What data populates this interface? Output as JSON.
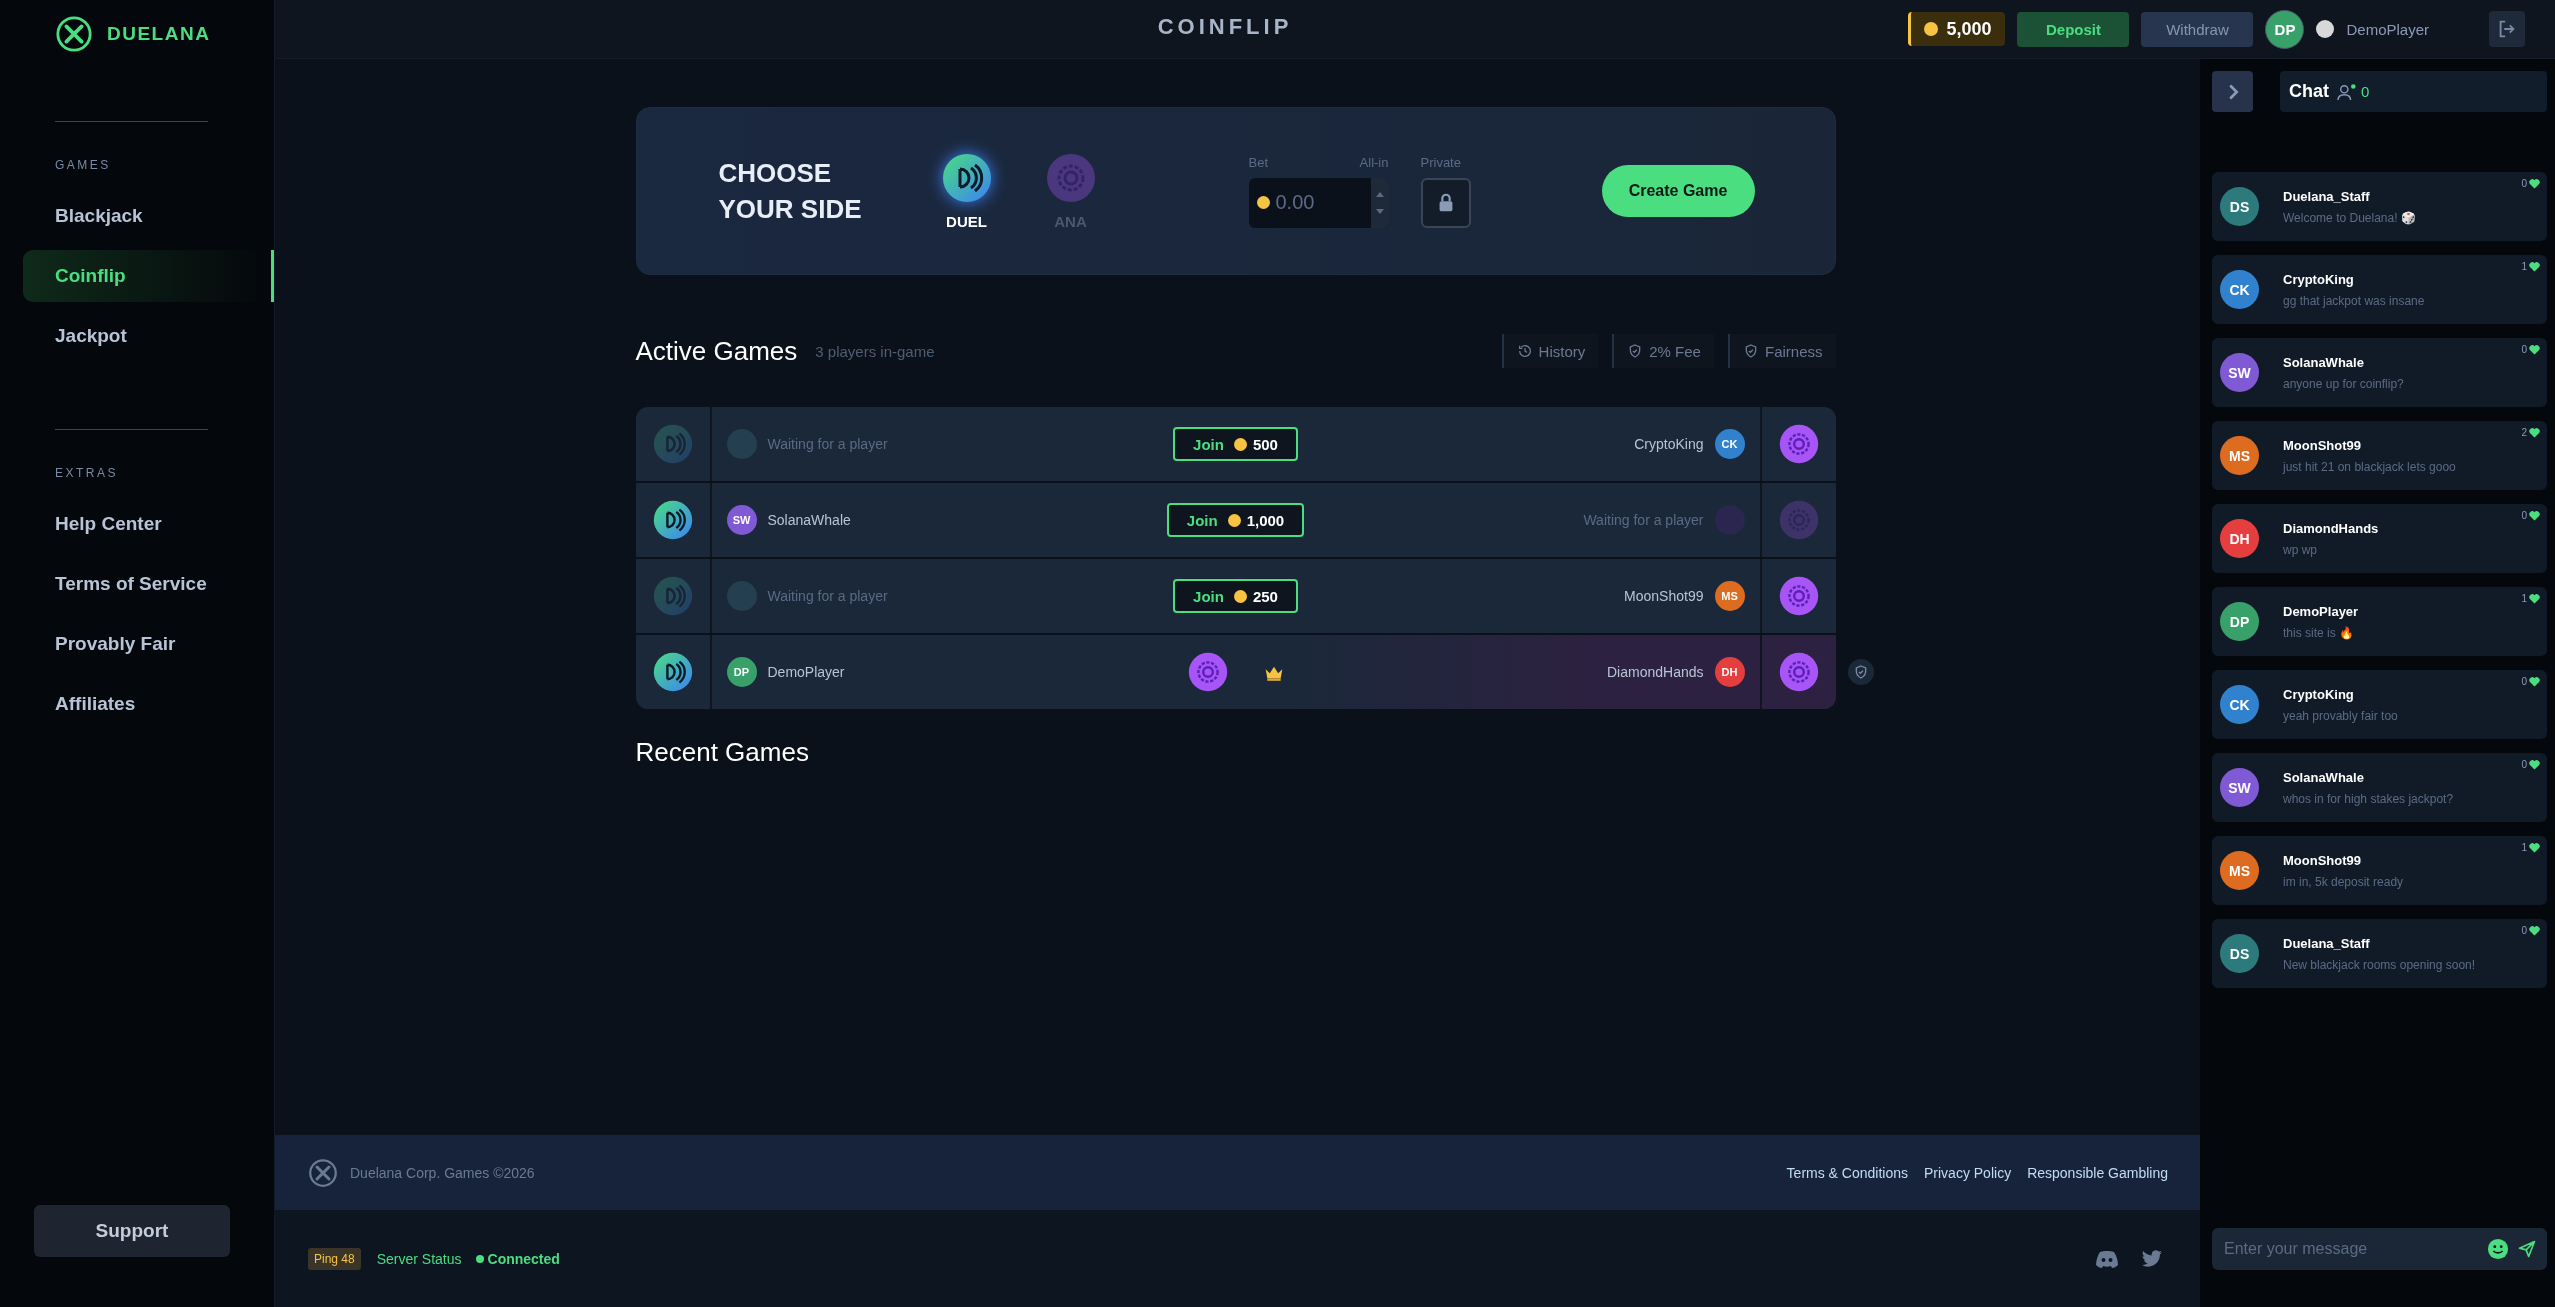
{
  "brand": {
    "name": "DUELANA"
  },
  "sidebar": {
    "sections": [
      {
        "heading": "GAMES",
        "items": [
          {
            "label": "Blackjack",
            "selected": false
          },
          {
            "label": "Coinflip",
            "selected": true
          },
          {
            "label": "Jackpot",
            "selected": false
          }
        ]
      },
      {
        "heading": "EXTRAS",
        "items": [
          {
            "label": "Help Center",
            "selected": false
          },
          {
            "label": "Terms of Service",
            "selected": false
          },
          {
            "label": "Provably Fair",
            "selected": false
          },
          {
            "label": "Affiliates",
            "selected": false
          }
        ]
      }
    ],
    "support": "Support"
  },
  "header": {
    "title": "COINFLIP",
    "balance": "5,000",
    "deposit": "Deposit",
    "withdraw": "Withdraw",
    "avatar": "DP",
    "username": "DemoPlayer"
  },
  "creator": {
    "heading": [
      "CHOOSE",
      "YOUR SIDE"
    ],
    "sides": [
      {
        "label": "DUEL",
        "kind": "duel",
        "selected": true
      },
      {
        "label": "ANA",
        "kind": "ana",
        "selected": false
      }
    ],
    "bet_label": "Bet",
    "all_in": "All-in",
    "bet_placeholder": "0.00",
    "private_label": "Private",
    "create": "Create Game"
  },
  "active_games": {
    "title": "Active Games",
    "subtitle": "3 players in-game",
    "tools": [
      {
        "label": "History",
        "kind": "history"
      },
      {
        "label": "2% Fee",
        "kind": "shield"
      },
      {
        "label": "Fairness",
        "kind": "shield"
      }
    ],
    "rows": [
      {
        "kind": "open",
        "left": {
          "waiting": true,
          "text": "Waiting for a player"
        },
        "amount": "500",
        "join": "Join",
        "right": {
          "waiting": false,
          "text": "CryptoKing",
          "initials": "CK",
          "color": "#3182ce"
        }
      },
      {
        "kind": "open",
        "left": {
          "waiting": false,
          "text": "SolanaWhale",
          "initials": "SW",
          "color": "#805ad5"
        },
        "amount": "1,000",
        "join": "Join",
        "right": {
          "waiting": true,
          "text": "Waiting for a player"
        }
      },
      {
        "kind": "open",
        "left": {
          "waiting": true,
          "text": "Waiting for a player"
        },
        "amount": "250",
        "join": "Join",
        "right": {
          "waiting": false,
          "text": "MoonShot99",
          "initials": "MS",
          "color": "#dd6b20"
        }
      },
      {
        "kind": "result",
        "left": {
          "waiting": false,
          "text": "DemoPlayer",
          "initials": "DP",
          "color": "#38a169"
        },
        "right": {
          "waiting": false,
          "text": "DiamondHands",
          "initials": "DH",
          "color": "#e53e3e"
        }
      }
    ]
  },
  "recent_games": {
    "title": "Recent Games"
  },
  "footer": {
    "copyright": "Duelana Corp. Games ©2026",
    "links": [
      "Terms & Conditions",
      "Privacy Policy",
      "Responsible Gambling"
    ]
  },
  "status_bar": {
    "ping": "Ping 48",
    "server_label": "Server Status",
    "connection": "Connected"
  },
  "chat": {
    "title": "Chat",
    "online": "0",
    "input_placeholder": "Enter your message",
    "messages": [
      {
        "initials": "DS",
        "color": "#2c7a7b",
        "name": "Duelana_Staff",
        "text": "Welcome to Duelana! 🎲",
        "likes": "0"
      },
      {
        "initials": "CK",
        "color": "#3182ce",
        "name": "CryptoKing",
        "text": "gg that jackpot was insane",
        "likes": "1"
      },
      {
        "initials": "SW",
        "color": "#805ad5",
        "name": "SolanaWhale",
        "text": "anyone up for coinflip?",
        "likes": "0"
      },
      {
        "initials": "MS",
        "color": "#dd6b20",
        "name": "MoonShot99",
        "text": "just hit 21 on blackjack lets gooo",
        "likes": "2"
      },
      {
        "initials": "DH",
        "color": "#e53e3e",
        "name": "DiamondHands",
        "text": "wp wp",
        "likes": "0"
      },
      {
        "initials": "DP",
        "color": "#38a169",
        "name": "DemoPlayer",
        "text": "this site is 🔥",
        "likes": "1"
      },
      {
        "initials": "CK",
        "color": "#3182ce",
        "name": "CryptoKing",
        "text": "yeah provably fair too",
        "likes": "0"
      },
      {
        "initials": "SW",
        "color": "#805ad5",
        "name": "SolanaWhale",
        "text": "whos in for high stakes jackpot?",
        "likes": "0"
      },
      {
        "initials": "MS",
        "color": "#dd6b20",
        "name": "MoonShot99",
        "text": "im in, 5k deposit ready",
        "likes": "1"
      },
      {
        "initials": "DS",
        "color": "#2c7a7b",
        "name": "Duelana_Staff",
        "text": "New blackjack rooms opening soon!",
        "likes": "0"
      }
    ]
  }
}
